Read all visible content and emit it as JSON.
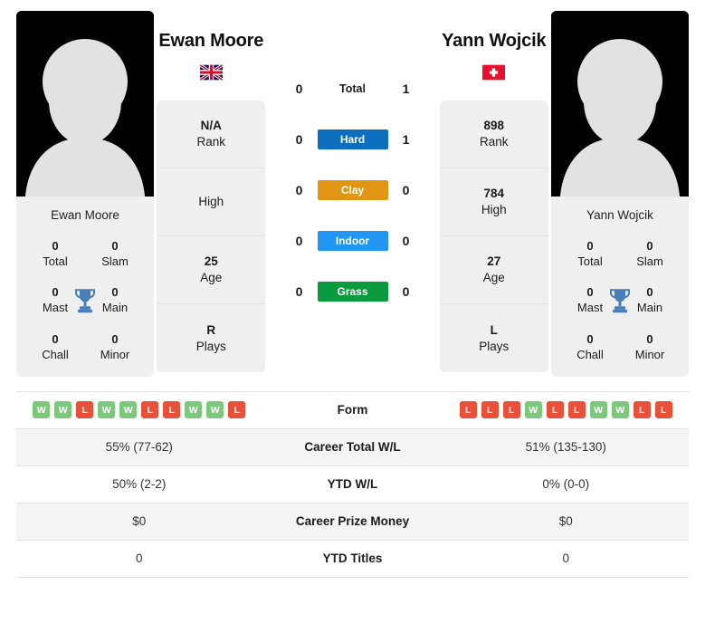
{
  "players": {
    "left": {
      "name": "Ewan Moore",
      "caption": "Ewan Moore",
      "flag": "gb-flag",
      "flag_country": "United Kingdom",
      "avatar": "player-silhouette-placeholder",
      "titles": [
        {
          "num": "0",
          "label": "Total"
        },
        {
          "num": "0",
          "label": "Slam"
        },
        {
          "num": "0",
          "label": "Mast"
        },
        {
          "num": "0",
          "label": "Main"
        },
        {
          "num": "0",
          "label": "Chall"
        },
        {
          "num": "0",
          "label": "Minor"
        }
      ],
      "info": [
        {
          "value": "N/A",
          "label": "Rank"
        },
        {
          "value": "",
          "label": "High"
        },
        {
          "value": "25",
          "label": "Age"
        },
        {
          "value": "R",
          "label": "Plays"
        }
      ],
      "form": [
        "W",
        "W",
        "L",
        "W",
        "W",
        "L",
        "L",
        "W",
        "W",
        "L"
      ],
      "stats": {
        "career_wl": "55% (77-62)",
        "ytd_wl": "50% (2-2)",
        "career_prize": "$0",
        "ytd_titles": "0"
      }
    },
    "right": {
      "name": "Yann Wojcik",
      "caption": "Yann Wojcik",
      "flag": "ch-flag",
      "flag_country": "Switzerland",
      "avatar": "player-silhouette-placeholder",
      "titles": [
        {
          "num": "0",
          "label": "Total"
        },
        {
          "num": "0",
          "label": "Slam"
        },
        {
          "num": "0",
          "label": "Mast"
        },
        {
          "num": "0",
          "label": "Main"
        },
        {
          "num": "0",
          "label": "Chall"
        },
        {
          "num": "0",
          "label": "Minor"
        }
      ],
      "info": [
        {
          "value": "898",
          "label": "Rank"
        },
        {
          "value": "784",
          "label": "High"
        },
        {
          "value": "27",
          "label": "Age"
        },
        {
          "value": "L",
          "label": "Plays"
        }
      ],
      "form": [
        "L",
        "L",
        "L",
        "W",
        "L",
        "L",
        "W",
        "W",
        "L",
        "L"
      ],
      "stats": {
        "career_wl": "51% (135-130)",
        "ytd_wl": "0% (0-0)",
        "career_prize": "$0",
        "ytd_titles": "0"
      }
    }
  },
  "surfaces": [
    {
      "label": "Total",
      "left": "0",
      "right": "1",
      "color": "transparent",
      "plain": true
    },
    {
      "label": "Hard",
      "left": "0",
      "right": "1",
      "color": "#0d6ebd",
      "plain": false
    },
    {
      "label": "Clay",
      "left": "0",
      "right": "0",
      "color": "#e09612",
      "plain": false
    },
    {
      "label": "Indoor",
      "left": "0",
      "right": "0",
      "color": "#2196f3",
      "plain": false
    },
    {
      "label": "Grass",
      "left": "0",
      "right": "0",
      "color": "#0a9b3f",
      "plain": false
    }
  ],
  "stats_rows": [
    {
      "label": "Form",
      "key": "form",
      "type": "form"
    },
    {
      "label": "Career Total W/L",
      "key": "career_wl",
      "type": "text"
    },
    {
      "label": "YTD W/L",
      "key": "ytd_wl",
      "type": "text"
    },
    {
      "label": "Career Prize Money",
      "key": "career_prize",
      "type": "text"
    },
    {
      "label": "YTD Titles",
      "key": "ytd_titles",
      "type": "text"
    }
  ],
  "colors": {
    "hard": "#0d6ebd",
    "clay": "#e09612",
    "indoor": "#2196f3",
    "grass": "#0a9b3f",
    "win": "#7ec87e",
    "loss": "#e8503a",
    "panel": "#efefef",
    "row_alt": "#f4f4f4"
  }
}
